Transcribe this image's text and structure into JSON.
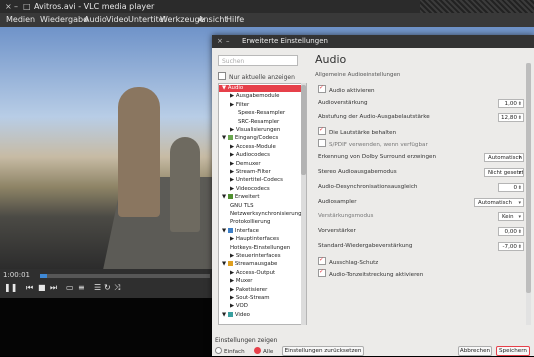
{
  "vlc": {
    "title": "Avitros.avi - VLC media player",
    "window_controls": [
      "×",
      "–",
      "□"
    ],
    "menu": [
      "Medien",
      "Wiedergabe",
      "Audio",
      "Video",
      "Untertitel",
      "Werkzeuge",
      "Ansicht",
      "Hilfe"
    ],
    "time_elapsed": "1:00:01",
    "seek_fraction": 0.04
  },
  "dialog": {
    "title": "Erweiterte Einstellungen",
    "window_controls": [
      "×",
      "–"
    ],
    "search_placeholder": "Suchen",
    "only_modified_label": "Nur aktuelle anzeigen",
    "tree": [
      {
        "label": "Audio",
        "level": 0,
        "arrow": "▼",
        "selected": true
      },
      {
        "label": "Ausgabemodule",
        "level": 1,
        "arrow": "▶"
      },
      {
        "label": "Filter",
        "level": 1,
        "arrow": "▶"
      },
      {
        "label": "Speex-Resampler",
        "level": 2
      },
      {
        "label": "SRC-Resampler",
        "level": 2
      },
      {
        "label": "Visualisierungen",
        "level": 1,
        "arrow": "▶"
      },
      {
        "label": "Eingang/Codecs",
        "level": 0,
        "arrow": "▼",
        "icon": "#6aa84f"
      },
      {
        "label": "Access-Module",
        "level": 1,
        "arrow": "▶"
      },
      {
        "label": "Audiocodecs",
        "level": 1,
        "arrow": "▶"
      },
      {
        "label": "Demuxer",
        "level": 1,
        "arrow": "▶"
      },
      {
        "label": "Stream-Filter",
        "level": 1,
        "arrow": "▶"
      },
      {
        "label": "Untertitel-Codecs",
        "level": 1,
        "arrow": "▶"
      },
      {
        "label": "Videocodecs",
        "level": 1,
        "arrow": "▶"
      },
      {
        "label": "Erweitert",
        "level": 0,
        "arrow": "▼",
        "icon": "#4f8f2f"
      },
      {
        "label": "GNU TLS",
        "level": 1
      },
      {
        "label": "Netzwerksynchronisierung",
        "level": 1
      },
      {
        "label": "Protokollierung",
        "level": 1
      },
      {
        "label": "Interface",
        "level": 0,
        "arrow": "▼",
        "icon": "#3d7fc7"
      },
      {
        "label": "Hauptinterfaces",
        "level": 1,
        "arrow": "▶"
      },
      {
        "label": "Hotkeys-Einstellungen",
        "level": 1
      },
      {
        "label": "Steuerinterfaces",
        "level": 1,
        "arrow": "▶"
      },
      {
        "label": "Streamausgabe",
        "level": 0,
        "arrow": "▼",
        "icon": "#e0a020"
      },
      {
        "label": "Access-Output",
        "level": 1,
        "arrow": "▶"
      },
      {
        "label": "Muxer",
        "level": 1,
        "arrow": "▶"
      },
      {
        "label": "Paketisierer",
        "level": 1,
        "arrow": "▶"
      },
      {
        "label": "Sout-Stream",
        "level": 1,
        "arrow": "▶"
      },
      {
        "label": "VOD",
        "level": 1,
        "arrow": "▶"
      },
      {
        "label": "Video",
        "level": 0,
        "arrow": "▼",
        "icon": "#3aa0a0"
      }
    ],
    "section_title": "Audio",
    "section_subtitle": "Allgemeine Audioeinstellungen",
    "audio_enable": "Audio aktivieren",
    "gain_label": "Audioverstärkung",
    "gain_value": "1,00",
    "volume_step_label": "Abstufung der Audio-Ausgabelautstärke",
    "volume_step_value": "12,80",
    "remember_volume": "Die Lautstärke behalten",
    "spdif": "S/PDIF verwenden, wenn verfügbar",
    "dolby_label": "Erkennung von Dolby Surround erzwingen",
    "dolby_value": "Automatisch",
    "stereo_label": "Stereo Audioausgabemodus",
    "stereo_value": "Nicht gesetzt",
    "desync_label": "Audio-Desynchronisationsausgleich",
    "desync_value": "0",
    "resampler_label": "Audiosampler",
    "resampler_value": "Automatisch",
    "replay_mode_label": "Verstärkungsmodus",
    "replay_mode_value": "Kein",
    "preamp_label": "Vorverstärker",
    "preamp_value": "0,00",
    "default_gain_label": "Standard-Wiedergabeverstärkung",
    "default_gain_value": "-7,00",
    "hearing_protection": "Ausschlag-Schutz",
    "time_stretch": "Audio-Tonzeitstreckung aktivieren",
    "show_settings_label": "Einstellungen zeigen",
    "simple_label": "Einfach",
    "all_label": "Alle",
    "reset_button": "Einstellungen zurücksetzen",
    "cancel_button": "Abbrechen",
    "save_button": "Speichern"
  }
}
